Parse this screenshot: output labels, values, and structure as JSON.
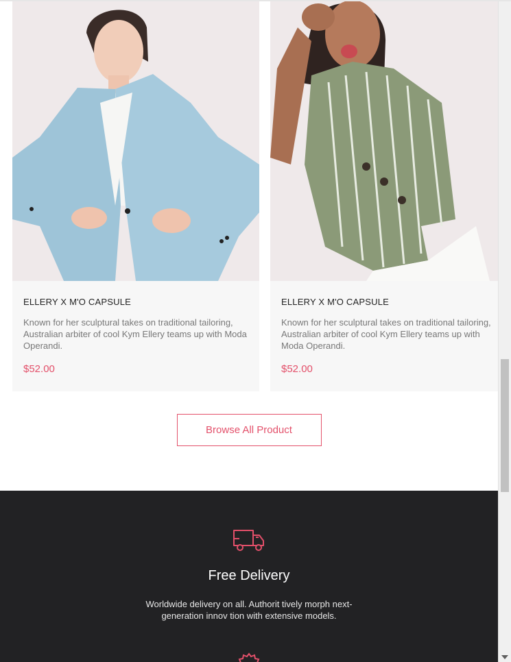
{
  "products": [
    {
      "title": "ELLERY X M'O CAPSULE",
      "description": "Known for her sculptural takes on traditional tailoring, Australian arbiter of cool Kym Ellery teams up with Moda Operandi.",
      "price": "$52.00",
      "image_subject": "woman in light blue blazer"
    },
    {
      "title": "ELLERY X M'O CAPSULE",
      "description": "Known for her sculptural takes on traditional tailoring, Australian arbiter of cool Kym Ellery teams up with Moda Operandi.",
      "price": "$52.00",
      "image_subject": "woman in green striped wrap top"
    }
  ],
  "browse_button": {
    "label": "Browse All Product"
  },
  "features": [
    {
      "icon": "delivery-truck-icon",
      "title": "Free Delivery",
      "description_lines": [
        "Worldwide delivery on all. Authorit tively morph next-",
        "generation innov tion with extensive models."
      ]
    },
    {
      "icon": "badge-icon"
    }
  ],
  "colors": {
    "accent": "#e3506a",
    "dark_section": "#222224",
    "card_bg": "#f7f7f7"
  }
}
